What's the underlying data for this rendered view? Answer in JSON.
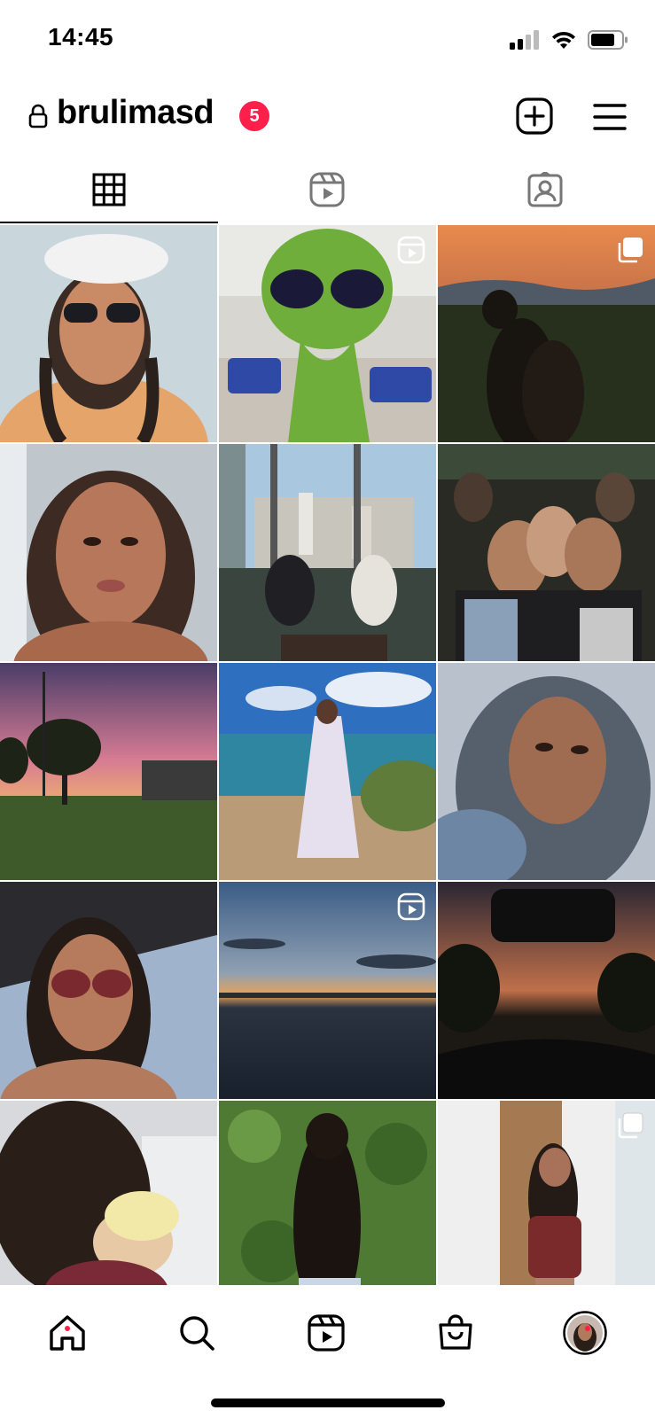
{
  "status_bar": {
    "time": "14:45"
  },
  "header": {
    "username": "brulimasd",
    "notification_count": "5"
  },
  "tabs": [
    {
      "name": "posts-grid",
      "active": true
    },
    {
      "name": "reels",
      "active": false
    },
    {
      "name": "tagged",
      "active": false
    }
  ],
  "grid": {
    "tiles": [
      {
        "subject": "selfie with cap and sunglasses",
        "badge": ""
      },
      {
        "subject": "alien figure in classroom",
        "badge": "reel"
      },
      {
        "subject": "couple at sunset viewpoint",
        "badge": "carousel"
      },
      {
        "subject": "selfie close-up",
        "badge": ""
      },
      {
        "subject": "couple dining by city window",
        "badge": ""
      },
      {
        "subject": "group of friends at party",
        "badge": ""
      },
      {
        "subject": "pink sunset with tree",
        "badge": ""
      },
      {
        "subject": "woman in dress at the beach",
        "badge": ""
      },
      {
        "subject": "selfie with blue-tinted hair",
        "badge": ""
      },
      {
        "subject": "selfie in car with sunglasses",
        "badge": ""
      },
      {
        "subject": "sunset over the water",
        "badge": "reel"
      },
      {
        "subject": "sunset road from car",
        "badge": ""
      },
      {
        "subject": "holding a newborn baby",
        "badge": ""
      },
      {
        "subject": "back view in front of hedge",
        "badge": ""
      },
      {
        "subject": "mirror selfie in bathroom",
        "badge": "carousel"
      }
    ]
  },
  "bottom_nav": {
    "items": [
      {
        "name": "home",
        "dot": true
      },
      {
        "name": "search",
        "dot": false
      },
      {
        "name": "reels",
        "dot": false
      },
      {
        "name": "shop",
        "dot": false
      },
      {
        "name": "profile",
        "dot": true
      }
    ]
  },
  "colors": {
    "accent": "#ff1f4b",
    "text": "#000000",
    "background": "#ffffff"
  }
}
